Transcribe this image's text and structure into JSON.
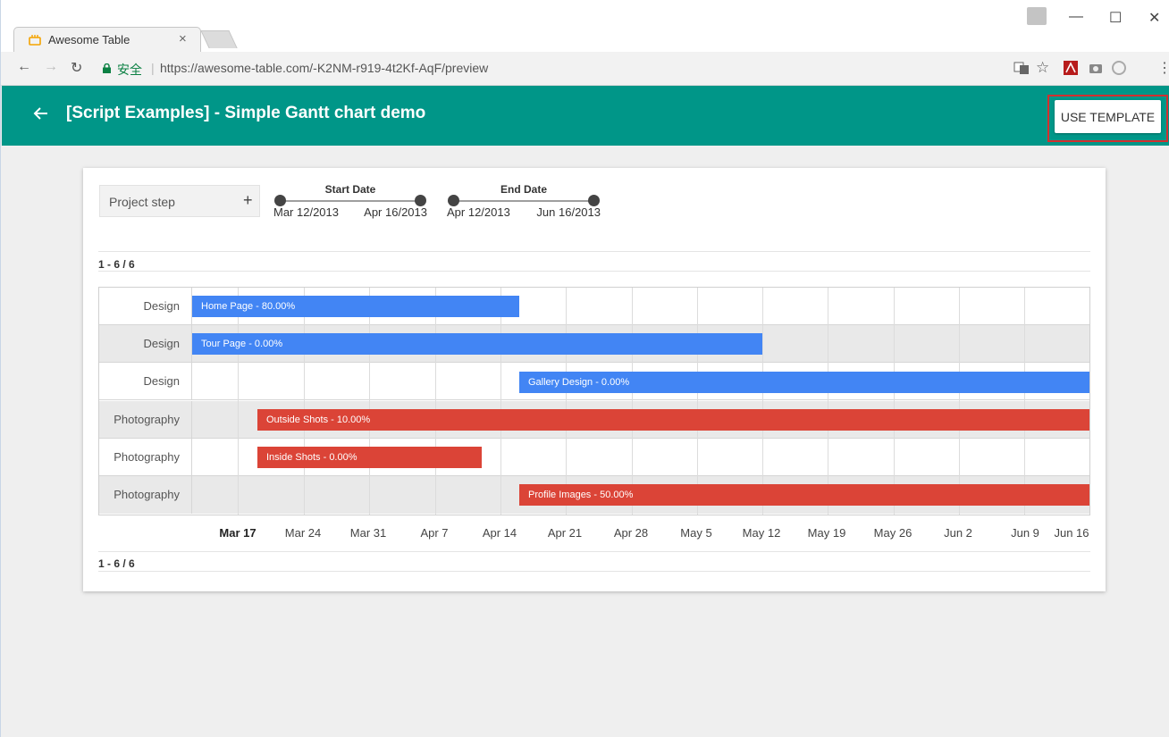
{
  "browser": {
    "tab_title": "Awesome Table",
    "tab_close": "×",
    "secure_label": "安全",
    "url": "https://awesome-table.com/-K2NM-r919-4t2Kf-AqF/preview",
    "icons": [
      "back-icon",
      "forward-icon",
      "reload-icon",
      "lock-icon",
      "translate-icon",
      "star-icon",
      "pdf-icon",
      "camera-icon",
      "extension-icon",
      "menu-icon"
    ]
  },
  "header": {
    "title": "[Script Examples] - Simple Gantt chart demo",
    "use_template_label": "USE TEMPLATE",
    "color": "#009688"
  },
  "filters": {
    "category_label": "Project step",
    "plus": "+",
    "start_range": {
      "title": "Start Date",
      "min": "Mar 12/2013",
      "max": "Apr 16/2013"
    },
    "end_range": {
      "title": "End Date",
      "min": "Apr 12/2013",
      "max": "Jun 16/2013"
    }
  },
  "pagination": {
    "top": "1 - 6 / 6",
    "bottom": "1 - 6 / 6"
  },
  "gantt": {
    "rows": [
      {
        "label": "Design",
        "task": "Home Page - 80.00%",
        "color": "#4285f4"
      },
      {
        "label": "Design",
        "task": "Tour Page - 0.00%",
        "color": "#4285f4"
      },
      {
        "label": "Design",
        "task": "Gallery Design - 0.00%",
        "color": "#4285f4"
      },
      {
        "label": "Photography",
        "task": "Outside Shots - 10.00%",
        "color": "#db4437"
      },
      {
        "label": "Photography",
        "task": "Inside Shots - 0.00%",
        "color": "#db4437"
      },
      {
        "label": "Photography",
        "task": "Profile Images - 50.00%",
        "color": "#db4437"
      }
    ],
    "axis_labels": [
      "Mar 17",
      "Mar 24",
      "Mar 31",
      "Apr 7",
      "Apr 14",
      "Apr 21",
      "Apr 28",
      "May 5",
      "May 12",
      "May 19",
      "May 26",
      "Jun 2",
      "Jun 9",
      "Jun 16"
    ]
  }
}
